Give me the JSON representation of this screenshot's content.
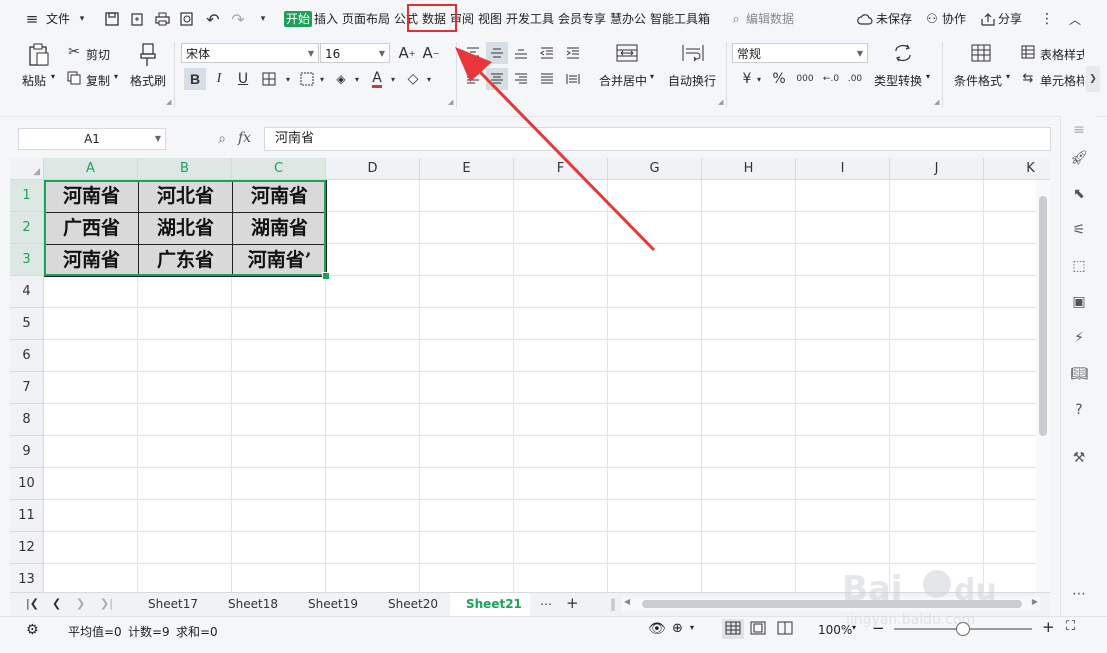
{
  "menubar": {
    "file_label": "文件",
    "tabs": [
      "开始",
      "插入",
      "页面布局",
      "公式",
      "数据",
      "审阅",
      "视图",
      "开发工具",
      "会员专享",
      "慧办公",
      "智能工具箱"
    ],
    "active_tab": "开始",
    "highlighted_tab": "数据",
    "search_placeholder": "编辑数据",
    "unsaved": "未保存",
    "collab": "协作",
    "share": "分享"
  },
  "ribbon": {
    "paste": "粘贴",
    "cut": "剪切",
    "copy": "复制",
    "format_painter": "格式刷",
    "font_name": "宋体",
    "font_size": "16",
    "merge_center": "合并居中",
    "wrap_text": "自动换行",
    "number_format": "常规",
    "type_convert": "类型转换",
    "conditional_format": "条件格式",
    "table_style": "表格样式",
    "cell_style": "单元格样式"
  },
  "formula_bar": {
    "name_box": "A1",
    "fx_label": "fx",
    "content": "河南省"
  },
  "sheet": {
    "columns": [
      "A",
      "B",
      "C",
      "D",
      "E",
      "F",
      "G",
      "H",
      "I",
      "J",
      "K"
    ],
    "selected_columns": [
      "A",
      "B",
      "C"
    ],
    "rows": [
      "1",
      "2",
      "3",
      "4",
      "5",
      "6",
      "7",
      "8",
      "9",
      "10",
      "11",
      "12",
      "13"
    ],
    "selected_rows": [
      "1",
      "2",
      "3"
    ],
    "data": [
      [
        "河南省",
        "河北省",
        "河南省"
      ],
      [
        "广西省",
        "湖北省",
        "湖南省"
      ],
      [
        "河南省",
        "广东省",
        "河南省’"
      ]
    ]
  },
  "sheet_tabs": {
    "tabs": [
      "Sheet17",
      "Sheet18",
      "Sheet19",
      "Sheet20",
      "Sheet21"
    ],
    "active": "Sheet21"
  },
  "status": {
    "average": "平均值=0",
    "count": "计数=9",
    "sum": "求和=0",
    "zoom": "100%"
  },
  "colors": {
    "accent": "#1aa356",
    "highlight_box": "#e03030",
    "arrow": "#e8373a"
  },
  "watermark": "Baidu经验 jingyan.baidu.com"
}
